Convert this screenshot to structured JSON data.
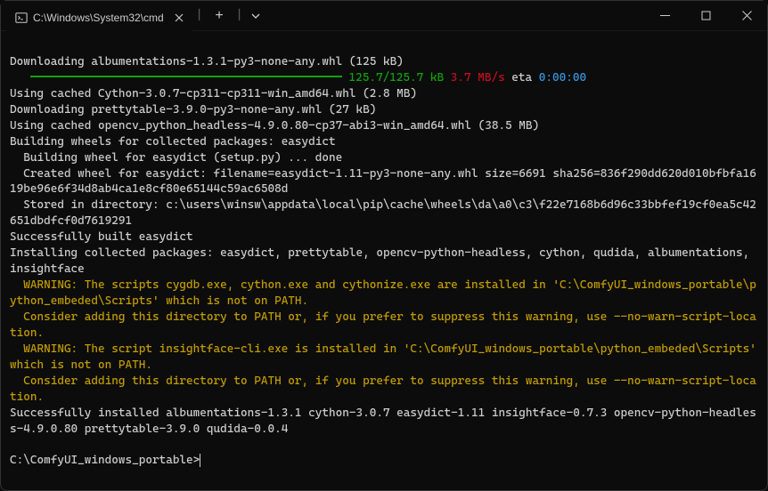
{
  "titlebar": {
    "tab_title": "C:\\Windows\\System32\\cmd",
    "tab_close": "✕",
    "new_tab": "+",
    "dropdown": "⌄"
  },
  "lines": {
    "l01": "Downloading albumentations-1.3.1-py3-none-any.whl (125 kB)",
    "l02a": "125.7/125.7 kB",
    "l02b": " 3.7 MB/s",
    "l02c": " eta ",
    "l02d": "0:00:00",
    "l03": "Using cached Cython-3.0.7-cp311-cp311-win_amd64.whl (2.8 MB)",
    "l04": "Downloading prettytable-3.9.0-py3-none-any.whl (27 kB)",
    "l05": "Using cached opencv_python_headless-4.9.0.80-cp37-abi3-win_amd64.whl (38.5 MB)",
    "l06": "Building wheels for collected packages: easydict",
    "l07": "  Building wheel for easydict (setup.py) ... done",
    "l08": "  Created wheel for easydict: filename=easydict-1.11-py3-none-any.whl size=6691 sha256=836f290dd620d010bfbfa1619be96e6f34d8ab4ca1e8cf80e65144c59ac6508d",
    "l09": "  Stored in directory: c:\\users\\winsw\\appdata\\local\\pip\\cache\\wheels\\da\\a0\\c3\\f22e7168b6d96c33bbfef19cf0ea5c42651dbdfcf0d7619291",
    "l10": "Successfully built easydict",
    "l11": "Installing collected packages: easydict, prettytable, opencv-python-headless, cython, qudida, albumentations, insightface",
    "l12": "  WARNING: The scripts cygdb.exe, cython.exe and cythonize.exe are installed in 'C:\\ComfyUI_windows_portable\\python_embeded\\Scripts' which is not on PATH.",
    "l13": "  Consider adding this directory to PATH or, if you prefer to suppress this warning, use --no-warn-script-location.",
    "l14": "  WARNING: The script insightface-cli.exe is installed in 'C:\\ComfyUI_windows_portable\\python_embeded\\Scripts' which is not on PATH.",
    "l15": "  Consider adding this directory to PATH or, if you prefer to suppress this warning, use --no-warn-script-location.",
    "l16": "Successfully installed albumentations-1.3.1 cython-3.0.7 easydict-1.11 insightface-0.7.3 opencv-python-headless-4.9.0.80 prettytable-3.9.0 qudida-0.0.4",
    "prompt": "C:\\ComfyUI_windows_portable>"
  }
}
